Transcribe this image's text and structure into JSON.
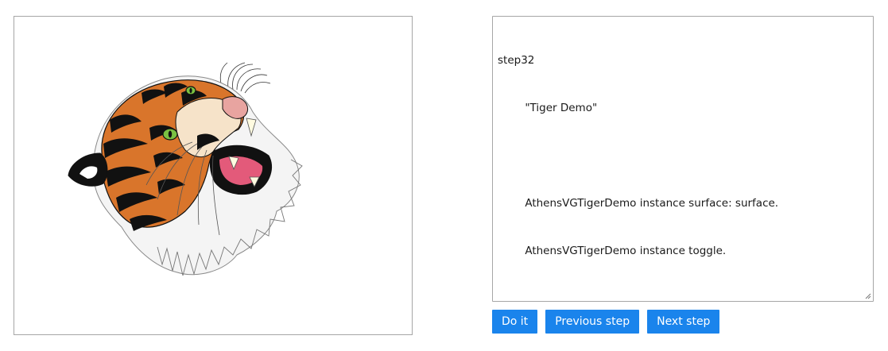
{
  "canvas": {
    "image_subject": "tiger-head-vector"
  },
  "editor": {
    "lines": [
      "step32",
      "        \"Tiger Demo\"",
      "",
      "        AthensVGTigerDemo instance surface: surface.",
      "        AthensVGTigerDemo instance toggle."
    ]
  },
  "buttons": {
    "do_it": "Do it",
    "previous_step": "Previous step",
    "next_step": "Next step"
  },
  "colors": {
    "button_bg": "#1a84ec",
    "button_text": "#ffffff",
    "border": "#a6a6a6",
    "tiger_orange": "#d9752b",
    "tiger_black": "#111111",
    "tiger_eye": "#7ac142",
    "tiger_mouth": "#e35a7a"
  }
}
